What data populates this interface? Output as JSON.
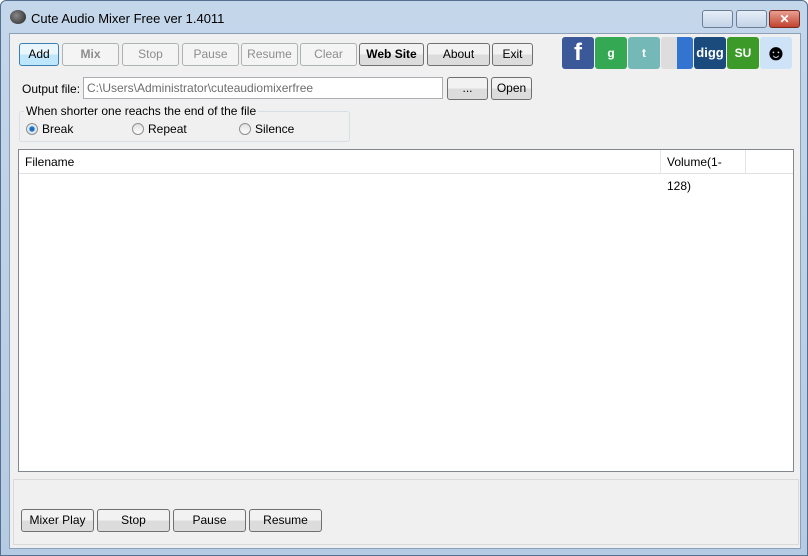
{
  "window": {
    "title": "Cute Audio Mixer Free ver 1.4011"
  },
  "toolbar": {
    "add": "Add",
    "mix": "Mix",
    "stop": "Stop",
    "pause": "Pause",
    "resume": "Resume",
    "clear": "Clear",
    "website": "Web Site",
    "about": "About",
    "exit": "Exit"
  },
  "social": [
    {
      "name": "facebook",
      "glyph": "f",
      "color": "#3b5998"
    },
    {
      "name": "google",
      "glyph": "g",
      "color": "#34a853"
    },
    {
      "name": "twitter",
      "glyph": "t",
      "color": "#74b8b8"
    },
    {
      "name": "delicious",
      "glyph": "",
      "color": "#3274d0"
    },
    {
      "name": "digg",
      "glyph": "digg",
      "color": "#1b4a7c"
    },
    {
      "name": "stumbleupon",
      "glyph": "SU",
      "color": "#3c9a28"
    },
    {
      "name": "reddit",
      "glyph": "☻",
      "color": "#cee3f8"
    }
  ],
  "output": {
    "label": "Output file:",
    "value": "C:\\Users\\Administrator\\cuteaudiomixerfree",
    "browse": "...",
    "open": "Open"
  },
  "mode": {
    "legend": "When shorter one reachs the end of the file",
    "options": [
      "Break",
      "Repeat",
      "Silence"
    ],
    "selected": "Break"
  },
  "list": {
    "columns": [
      "Filename",
      "Volume(1-128)"
    ],
    "rows": []
  },
  "player": {
    "play": "Mixer Play",
    "stop": "Stop",
    "pause": "Pause",
    "resume": "Resume"
  }
}
